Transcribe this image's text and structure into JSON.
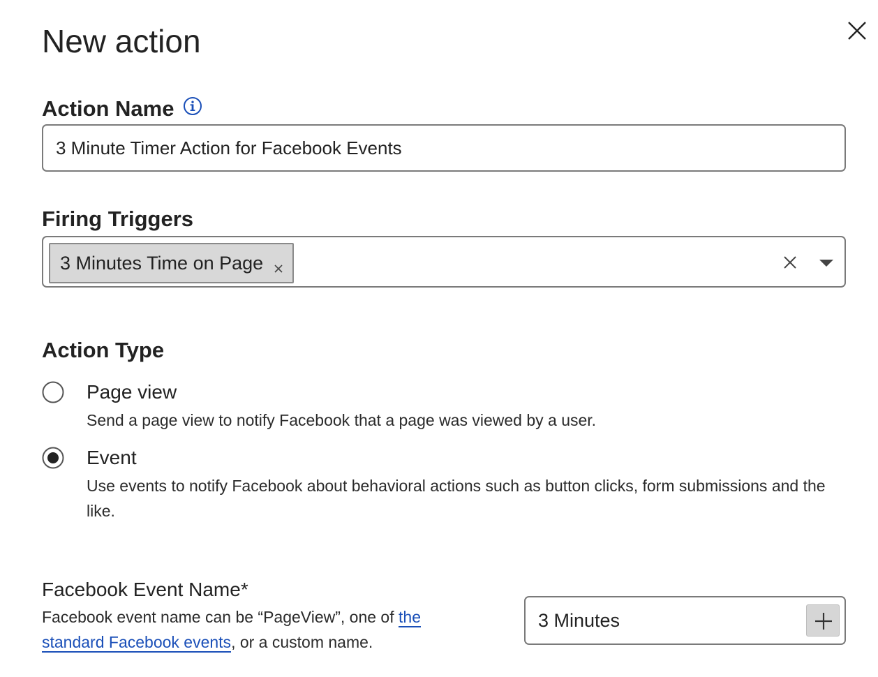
{
  "dialog": {
    "title": "New action"
  },
  "action_name": {
    "label": "Action Name",
    "value": "3 Minute Timer Action for Facebook Events",
    "info_icon": "info-icon"
  },
  "firing_triggers": {
    "label": "Firing Triggers",
    "selected": [
      "3 Minutes Time on Page"
    ]
  },
  "action_type": {
    "label": "Action Type",
    "selected": "event",
    "options": [
      {
        "id": "page-view",
        "title": "Page view",
        "description": "Send a page view to notify Facebook that a page was viewed by a user."
      },
      {
        "id": "event",
        "title": "Event",
        "description": "Use events to notify Facebook about behavioral actions such as button clicks, form submissions and the like."
      }
    ]
  },
  "facebook_event": {
    "label": "Facebook Event Name*",
    "help_prefix": "Facebook event name can be “PageView”, one of ",
    "help_link": "the standard Facebook events",
    "help_suffix": ", or a custom name.",
    "value": "3 Minutes"
  },
  "colors": {
    "link": "#1a4fb8",
    "chip_background": "#d8d8d8",
    "border": "#7a7a7a"
  }
}
